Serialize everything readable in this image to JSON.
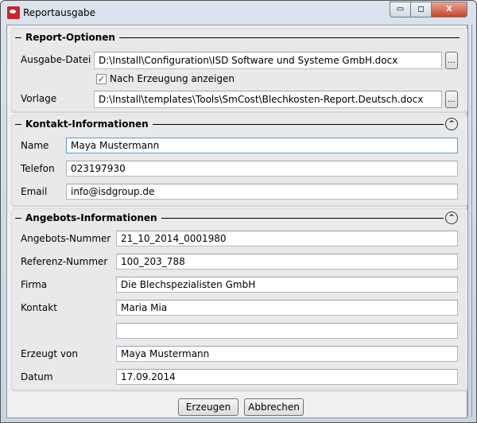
{
  "window": {
    "title": "Reportausgabe",
    "minimize": "▭",
    "maximize": "◻",
    "close": "X"
  },
  "report_options": {
    "header": "Report-Optionen",
    "output_label": "Ausgabe-Datei",
    "output_value": "D:\\Install\\Configuration\\ISD Software und Systeme GmbH.docx",
    "browse": "...",
    "show_after_label": "Nach Erzeugung anzeigen",
    "show_after_checked": true,
    "check_mark": "✓",
    "template_label": "Vorlage",
    "template_value": "D:\\Install\\templates\\Tools\\SmCost\\Blechkosten-Report.Deutsch.docx"
  },
  "contact": {
    "header": "Kontakt-Informationen",
    "collapse": "^",
    "fields": [
      {
        "label": "Name",
        "value": "Maya Mustermann"
      },
      {
        "label": "Telefon",
        "value": "023197930"
      },
      {
        "label": "Email",
        "value": "info@isdgroup.de"
      }
    ]
  },
  "offer": {
    "header": "Angebots-Informationen",
    "collapse": "^",
    "fields": [
      {
        "label": "Angebots-Nummer",
        "value": "21_10_2014_0001980"
      },
      {
        "label": "Referenz-Nummer",
        "value": "100_203_788"
      },
      {
        "label": "Firma",
        "value": "Die Blechspezialisten GmbH"
      },
      {
        "label": "Kontakt",
        "value": "Maria Mia"
      },
      {
        "label": "",
        "value": ""
      },
      {
        "label": "Erzeugt von",
        "value": "Maya Mustermann"
      },
      {
        "label": "Datum",
        "value": "17.09.2014"
      }
    ]
  },
  "buttons": {
    "create": "Erzeugen",
    "cancel": "Abbrechen"
  }
}
